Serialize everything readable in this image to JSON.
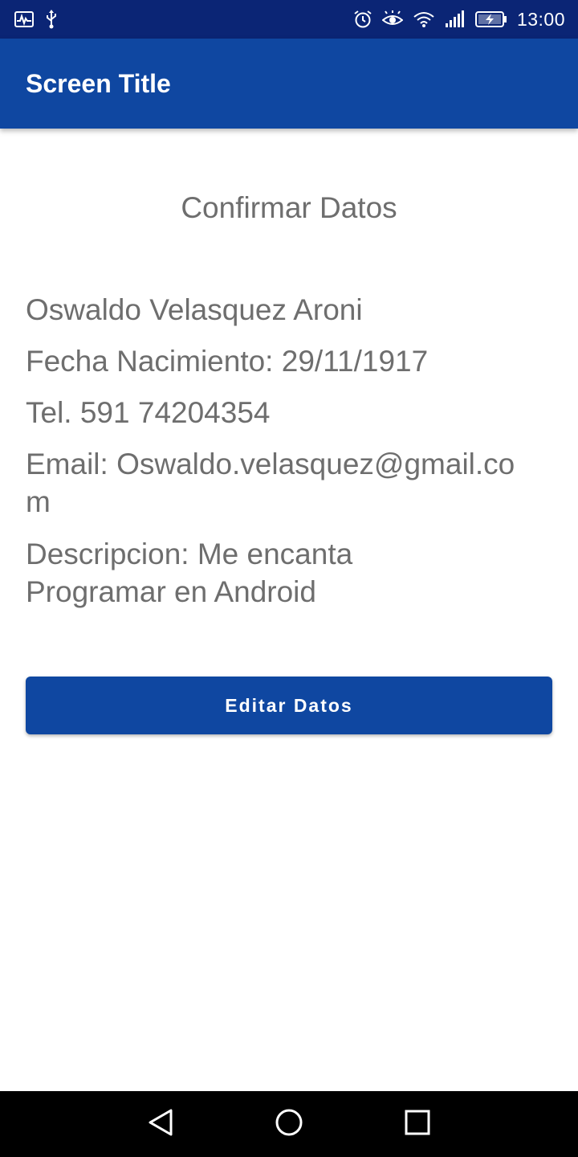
{
  "status_bar": {
    "time": "13:00",
    "left_icons": [
      "activity-icon",
      "usb-icon"
    ],
    "right_icons": [
      "alarm-icon",
      "eye-icon",
      "wifi-icon",
      "signal-icon",
      "battery-icon"
    ],
    "background": "#0b2575"
  },
  "app_bar": {
    "title": "Screen Title",
    "background": "#0f47a1"
  },
  "content": {
    "heading": "Confirmar Datos",
    "name": "Oswaldo Velasquez Aroni",
    "birth_date": "Fecha Nacimiento: 29/11/1917",
    "phone": "Tel. 591 74204354",
    "email": "Email: Oswaldo.velasquez@gmail.com",
    "description": "Descripcion: Me encanta Programar en Android",
    "text_color": "#6e6e6e"
  },
  "actions": {
    "edit_label": "Editar Datos",
    "edit_color": "#0f47a1"
  },
  "nav_bar": {
    "buttons": [
      "back-icon",
      "home-icon",
      "recents-icon"
    ]
  }
}
